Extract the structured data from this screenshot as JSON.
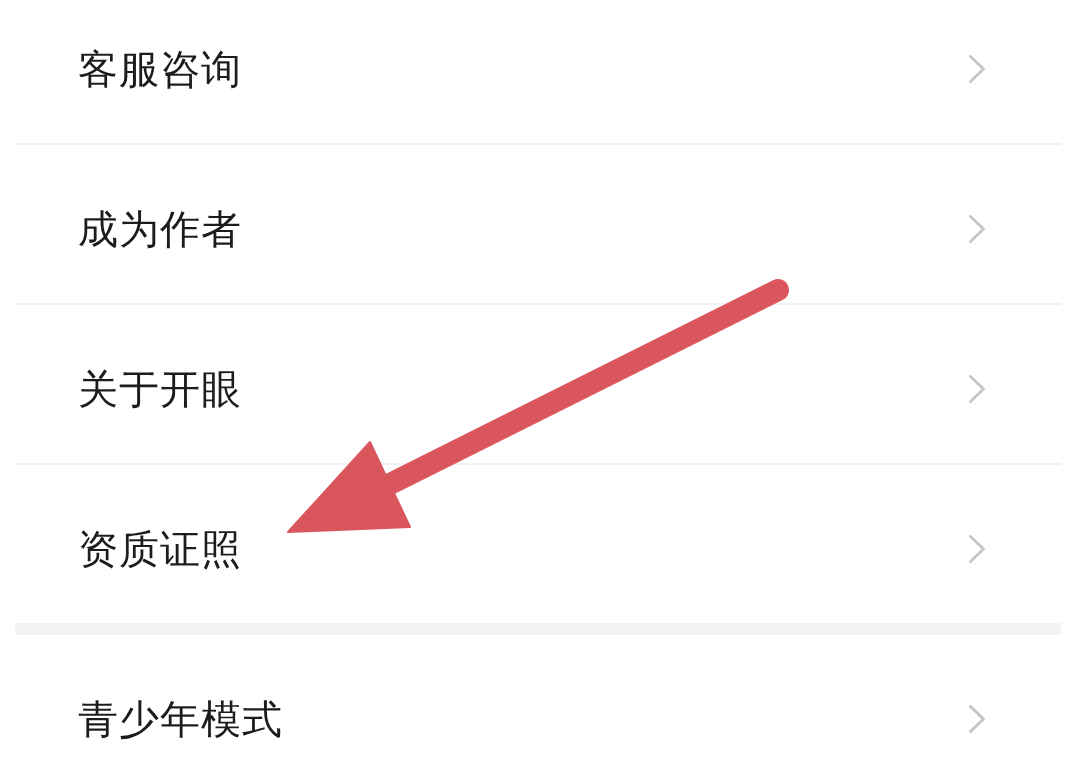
{
  "sections": [
    {
      "items": [
        {
          "label": "客服咨询",
          "pointed_at": false
        },
        {
          "label": "成为作者",
          "pointed_at": false
        },
        {
          "label": "关于开眼",
          "pointed_at": false
        },
        {
          "label": "资质证照",
          "pointed_at": true
        }
      ]
    },
    {
      "items": [
        {
          "label": "青少年模式",
          "pointed_at": false
        }
      ]
    }
  ]
}
